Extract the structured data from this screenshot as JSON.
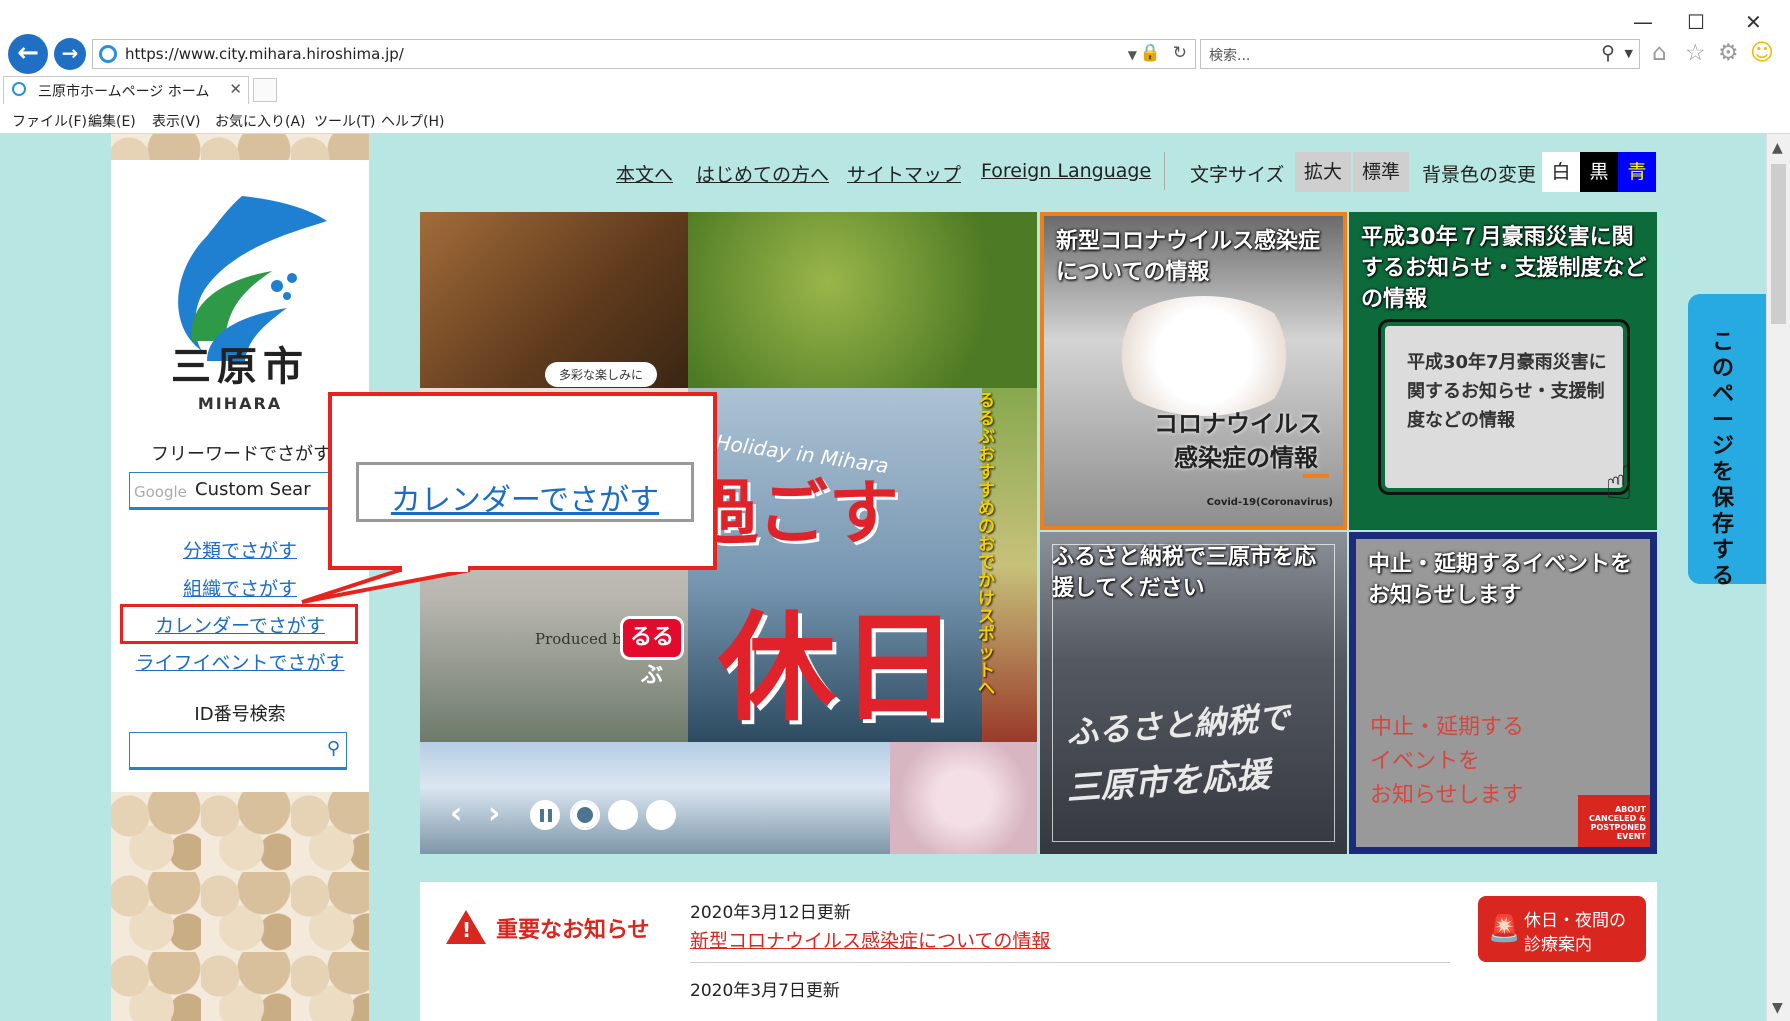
{
  "browser": {
    "url": "https://www.city.mihara.hiroshima.jp/",
    "search_placeholder": "検索...",
    "tab_title": "三原市ホームページ ホーム",
    "menu": [
      "ファイル(F)",
      "編集(E)",
      "表示(V)",
      "お気に入り(A)",
      "ツール(T)",
      "ヘルプ(H)"
    ],
    "window_controls": {
      "minimize": "—",
      "maximize": "☐",
      "close": "✕"
    }
  },
  "sidebar": {
    "logo_name": "三原市",
    "logo_en": "MIHARA",
    "freeword_label": "フリーワードでさがす",
    "google_label": "Google",
    "custom_search_text": "Custom Sear",
    "links": [
      "分類でさがす",
      "組織でさがす",
      "カレンダーでさがす",
      "ライフイベントでさがす"
    ],
    "id_search_label": "ID番号検索"
  },
  "topnav": {
    "links": [
      "本文へ",
      "はじめての方へ",
      "サイトマップ",
      "Foreign Language"
    ],
    "font_size_label": "文字サイズ",
    "font_buttons": [
      "拡大",
      "標準"
    ],
    "bg_label": "背景色の変更",
    "bg_buttons": [
      {
        "label": "白",
        "bg": "#ffffff",
        "fg": "#222222"
      },
      {
        "label": "黒",
        "bg": "#000000",
        "fg": "#ffffff"
      },
      {
        "label": "青",
        "bg": "#0000ff",
        "fg": "#ffff00"
      }
    ]
  },
  "banner": {
    "slide": {
      "caption": "多彩な楽しみに",
      "subtitle": "Holiday in Mihara",
      "title_part1": "過ごす",
      "title_part2": "休日",
      "vertical_text": "るるぶおすすめのおでかけスポットへ",
      "produced_by": "Produced by",
      "rurubu_logo": "るるぶ"
    },
    "tiles": {
      "corona_title": "新型コロナウイルス感染症についての情報",
      "corona_inner_1": "コロナウイルス",
      "corona_inner_2": "感染症の情報",
      "corona_small": "Covid-19(Coronavirus)",
      "flood_title": "平成30年７月豪雨災害に関するお知らせ・支援制度などの情報",
      "flood_inner": "平成30年7月豪雨災害に関するお知らせ・支援制度などの情報",
      "furusato_title": "ふるさと納税で三原市を応援してください",
      "furusato_inner_1": "ふるさと納税で",
      "furusato_inner_2": "三原市を応援",
      "event_title": "中止・延期するイベントをお知らせします",
      "event_inner_1": "中止・延期する",
      "event_inner_2": "イベントを",
      "event_inner_3": "お知らせします",
      "event_badge": "ABOUT CANCELED & POSTPONED EVENT"
    }
  },
  "save_tab": "このページを保存する",
  "notice": {
    "title": "重要なお知らせ",
    "item1_date": "2020年3月12日更新",
    "item1_link": "新型コロナウイルス感染症についての情報",
    "item2_date": "2020年3月7日更新",
    "clinic_line1": "休日・夜間の",
    "clinic_line2": "診療案内"
  },
  "callout": {
    "text": "カレンダーでさがす"
  },
  "colors": {
    "page_bg": "#b8e7e3",
    "link_blue": "#1a6cc4",
    "highlight_red": "#e8231d",
    "notice_red": "#d9261e"
  }
}
